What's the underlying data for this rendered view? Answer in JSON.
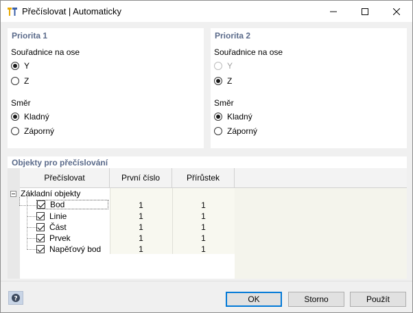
{
  "window": {
    "title": "Přečíslovat | Automaticky"
  },
  "priority1": {
    "title": "Priorita 1",
    "axis_label": "Souřadnice na ose",
    "axis_options": [
      {
        "label": "Y",
        "checked": true
      },
      {
        "label": "Z",
        "checked": false
      }
    ],
    "direction_label": "Směr",
    "direction_options": [
      {
        "label": "Kladný",
        "checked": true
      },
      {
        "label": "Záporný",
        "checked": false
      }
    ]
  },
  "priority2": {
    "title": "Priorita 2",
    "axis_label": "Souřadnice na ose",
    "axis_options": [
      {
        "label": "Y",
        "checked": false,
        "disabled": true
      },
      {
        "label": "Z",
        "checked": true
      }
    ],
    "direction_label": "Směr",
    "direction_options": [
      {
        "label": "Kladný",
        "checked": true
      },
      {
        "label": "Záporný",
        "checked": false
      }
    ]
  },
  "objects": {
    "title": "Objekty pro přečíslování",
    "columns": [
      "Přečíslovat",
      "První číslo",
      "Přírůstek"
    ],
    "group": "Základní objekty",
    "rows": [
      {
        "name": "Bod",
        "first": "1",
        "increment": "1",
        "checked": true
      },
      {
        "name": "Linie",
        "first": "1",
        "increment": "1",
        "checked": true
      },
      {
        "name": "Část",
        "first": "1",
        "increment": "1",
        "checked": true
      },
      {
        "name": "Prvek",
        "first": "1",
        "increment": "1",
        "checked": true
      },
      {
        "name": "Napěťový bod",
        "first": "1",
        "increment": "1",
        "checked": true
      }
    ]
  },
  "buttons": {
    "ok": "OK",
    "cancel": "Storno",
    "apply": "Použít"
  },
  "icons": {
    "app": "renumber-icon",
    "help": "help-icon"
  }
}
